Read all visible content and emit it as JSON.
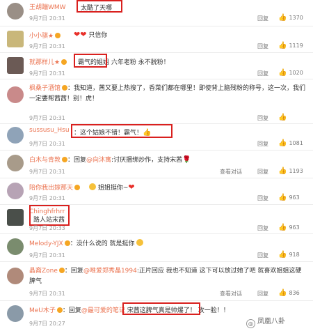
{
  "comments": [
    {
      "user": "王胡蹦WMW",
      "text": "太酷了天哪",
      "time": "9月7日 20:31",
      "reply": "回复",
      "likes": "1370",
      "avatar_color": "#9a8f86"
    },
    {
      "user": "小小骐★",
      "text": "只信你",
      "time": "9月7日 20:31",
      "reply": "回复",
      "likes": "1119",
      "avatar_color": "#c9b77a"
    },
    {
      "user": "就那样儿★",
      "text_boxed": "霸气的姐姐",
      "text": "六年老粉 永不脱粉！",
      "time": "9月7日 20:31",
      "reply": "回复",
      "likes": "1020",
      "avatar_color": "#6b5a55"
    },
    {
      "user": "枫桑子酒馆",
      "text": "：我知道，茜又要上热搜了，香菜们都在哪里！即使背上脑残粉的称号，这一次，我们一定要帮茜茜！别！虎！",
      "time": "9月7日 20:31",
      "reply": "回复",
      "likes": "",
      "avatar_color": "#c98a8a"
    },
    {
      "user": "sussusu_Hsu",
      "text": "：这个姑娘不错！霸气！",
      "time": "9月7日 20:31",
      "reply": "回复",
      "likes": "1081",
      "avatar_color": "#8fa3b8"
    },
    {
      "user": "白木与青敦",
      "text_pre": "：回复",
      "mention": "@向沐寓",
      "text": ":讨厌捆绑炒作，支持宋茜",
      "time": "9月7日 20:31",
      "view": "查看对话",
      "reply": "回复",
      "likes": "1193",
      "avatar_color": "#a89b8a"
    },
    {
      "user": "陪你我出嫁那天",
      "text": "姐姐挺你~",
      "time": "9月7日 20:31",
      "reply": "回复",
      "likes": "963",
      "avatar_color": "#b7a3b5"
    },
    {
      "user": "Chinghfrhrr",
      "text": "路人站宋茜",
      "time": "9月7日 20:33",
      "reply": "回复",
      "likes": "963",
      "avatar_color": "#4a4f4a"
    },
    {
      "user": "Melody-YJX",
      "text": "：没什么说的 就是挺你",
      "time": "9月7日 20:31",
      "reply": "回复",
      "likes": "918",
      "avatar_color": "#7a8c6e"
    },
    {
      "user": "晶裔Zone",
      "text_pre": "：回复",
      "mention": "@唯爱郑秀晶1994",
      "text": ":正片回应 我也不知道 这下可以放过她了吧 就喜欢姐姐这硬脾气",
      "time": "9月7日 20:31",
      "view": "查看对话",
      "reply": "回复",
      "likes": "836",
      "avatar_color": "#b08a7a"
    },
    {
      "user": "MeU木子",
      "text_pre": "：回复",
      "mention": "@最可爱的笔记",
      "text_boxed": "宋茜这脾气真是帅爆了！",
      "text": "攻一脸！！",
      "time": "9月7日 20:27",
      "view": "",
      "reply": "",
      "likes": "",
      "avatar_color": "#8a9aa8"
    }
  ],
  "watermark": "凤凰八卦"
}
